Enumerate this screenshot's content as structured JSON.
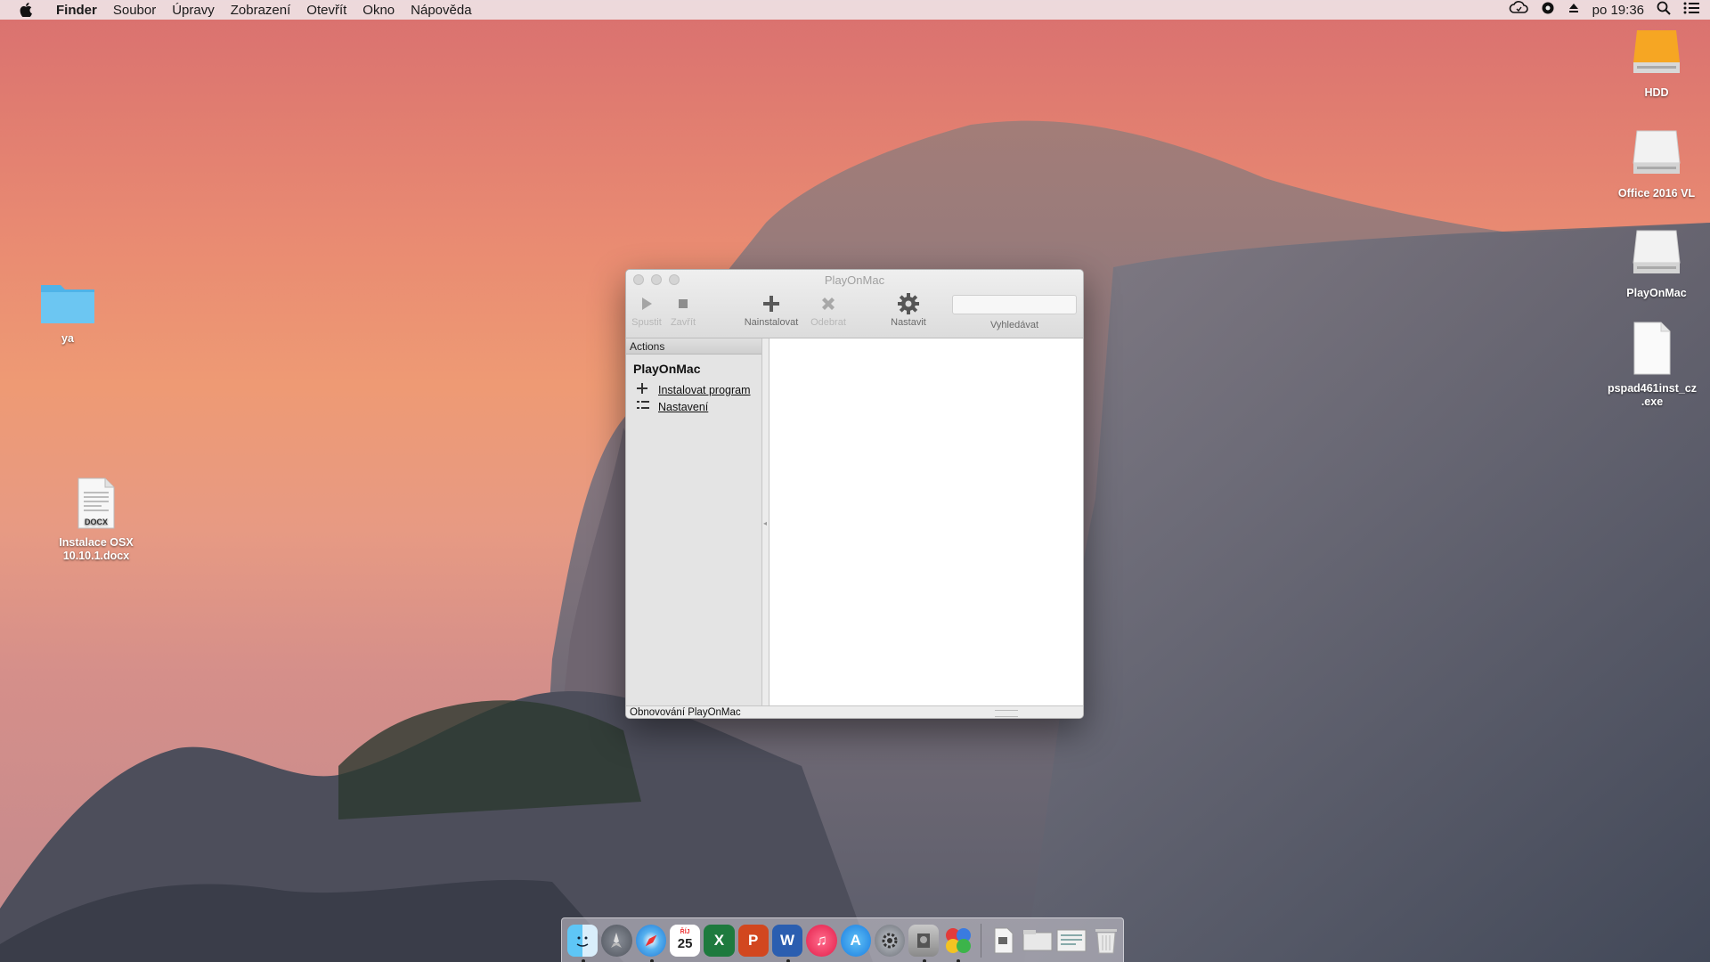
{
  "menubar": {
    "app": "Finder",
    "items": [
      "Soubor",
      "Úpravy",
      "Zobrazení",
      "Otevřít",
      "Okno",
      "Nápověda"
    ],
    "clock": "po 19:36"
  },
  "desktop": {
    "left_icons": [
      {
        "label": "ya"
      },
      {
        "label": "Instalace OSX 10.10.1.docx",
        "badge": "DOCX"
      }
    ],
    "right_icons": [
      {
        "label": "HDD"
      },
      {
        "label": "Office 2016 VL"
      },
      {
        "label": "PlayOnMac"
      },
      {
        "label": "pspad461inst_cz .exe"
      }
    ]
  },
  "window": {
    "title": "PlayOnMac",
    "toolbar": {
      "run": "Spustit",
      "close": "Zavřít",
      "install": "Nainstalovat",
      "remove": "Odebrat",
      "configure": "Nastavit",
      "search": "Vyhledávat"
    },
    "sidebar": {
      "header": "Actions",
      "section": "PlayOnMac",
      "actions": [
        {
          "label": "Instalovat program",
          "icon": "plus-icon"
        },
        {
          "label": "Nastavení",
          "icon": "list-icon"
        }
      ]
    },
    "status": "Obnovování PlayOnMac"
  },
  "dock": {
    "calendar_day": "25",
    "calendar_month": "ŘÍJ"
  }
}
